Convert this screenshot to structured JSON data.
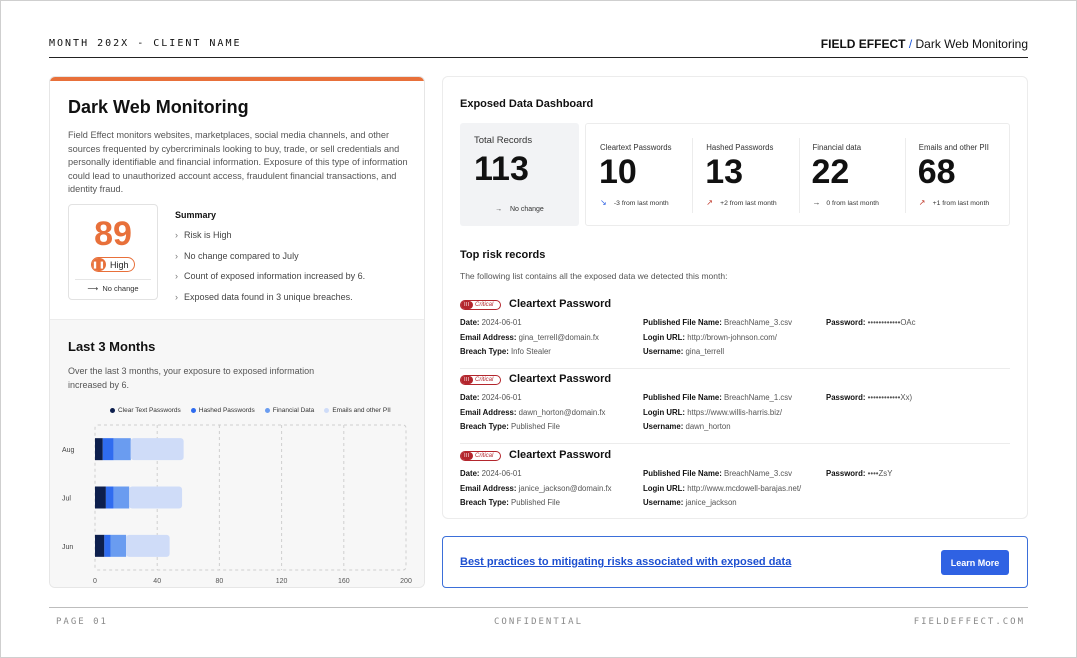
{
  "header": {
    "left": "MONTH 202X - CLIENT NAME",
    "brand": "FIELD EFFECT",
    "separator": "/",
    "section": "Dark Web Monitoring"
  },
  "overview": {
    "title": "Dark Web Monitoring",
    "description": "Field Effect monitors websites, marketplaces, social media channels, and other sources frequented by cybercriminals looking to buy, trade, or sell credentials and personally identifiable and financial information. Exposure of this type of information could lead to unauthorized account access, fraudulent financial transactions, and identity fraud.",
    "score": "89",
    "level": "High",
    "score_change": "No change",
    "summary_title": "Summary",
    "summary_items": [
      "Risk is High",
      "No change compared to July",
      "Count of exposed information increased by 6.",
      "Exposed data found in 3 unique breaches."
    ]
  },
  "last3": {
    "title": "Last 3 Months",
    "description": "Over the last 3 months, your exposure to exposed information increased by 6."
  },
  "chart_data": {
    "type": "bar",
    "orientation": "horizontal",
    "stacked": true,
    "categories": [
      "Aug",
      "Jul",
      "Jun"
    ],
    "series": [
      {
        "name": "Clear Text Passwords",
        "color": "#0d1f4d",
        "values": [
          5,
          7,
          6
        ]
      },
      {
        "name": "Hashed Passwords",
        "color": "#2f6cf0",
        "values": [
          7,
          5,
          4
        ]
      },
      {
        "name": "Financial Data",
        "color": "#6a9cf0",
        "values": [
          11,
          10,
          10
        ]
      },
      {
        "name": "Emails and other PII",
        "color": "#cfdcf8",
        "values": [
          34,
          34,
          28
        ]
      }
    ],
    "xticks": [
      0,
      40,
      80,
      120,
      160,
      200
    ],
    "xlim": [
      0,
      200
    ],
    "legend": "top"
  },
  "dashboard": {
    "title": "Exposed Data Dashboard",
    "total_label": "Total Records",
    "total_value": "113",
    "total_change_icon": "→",
    "total_change": "No change",
    "stats": [
      {
        "label": "Cleartext Passwords",
        "value": "10",
        "icon": "trend-down-icon",
        "glyph": "↘",
        "glyph_color": "#2f62e3",
        "change": "-3 from last month"
      },
      {
        "label": "Hashed Passwords",
        "value": "13",
        "icon": "trend-up-icon",
        "glyph": "↗",
        "glyph_color": "#c0392b",
        "change": "+2 from last month"
      },
      {
        "label": "Financial data",
        "value": "22",
        "icon": "arrow-right-icon",
        "glyph": "→",
        "glyph_color": "#333333",
        "change": "0 from last month"
      },
      {
        "label": "Emails and other PII",
        "value": "68",
        "icon": "trend-up-icon",
        "glyph": "↗",
        "glyph_color": "#c0392b",
        "change": "+1 from last month"
      }
    ]
  },
  "top_risk": {
    "title": "Top risk records",
    "description": "The following list contains all the exposed data we detected this month:",
    "records": [
      {
        "badge": "Critical",
        "title": "Cleartext Password",
        "date_label": "Date:",
        "date": "2024-06-01",
        "email_label": "Email Address:",
        "email": "gina_terrell@domain.fx",
        "breach_label": "Breach Type:",
        "breach": "Info Stealer",
        "file_label": "Published File Name:",
        "file": "BreachName_3.csv",
        "url_label": "Login URL:",
        "url": "http://brown-johnson.com/",
        "user_label": "Username:",
        "user": "gina_terrell",
        "password_label": "Password:",
        "password": "••••••••••••OAc"
      },
      {
        "badge": "Critical",
        "title": "Cleartext Password",
        "date_label": "Date:",
        "date": "2024-06-01",
        "email_label": "Email Address:",
        "email": "dawn_horton@domain.fx",
        "breach_label": "Breach Type:",
        "breach": "Published File",
        "file_label": "Published File Name:",
        "file": "BreachName_1.csv",
        "url_label": "Login URL:",
        "url": "https://www.willis-harris.biz/",
        "user_label": "Username:",
        "user": "dawn_horton",
        "password_label": "Password:",
        "password": "••••••••••••Xx)"
      },
      {
        "badge": "Critical",
        "title": "Cleartext Password",
        "date_label": "Date:",
        "date": "2024-06-01",
        "email_label": "Email Address:",
        "email": "janice_jackson@domain.fx",
        "breach_label": "Breach Type:",
        "breach": "Published File",
        "file_label": "Published File Name:",
        "file": "BreachName_3.csv",
        "url_label": "Login URL:",
        "url": "http://www.mcdowell-barajas.net/",
        "user_label": "Username:",
        "user": "janice_jackson",
        "password_label": "Password:",
        "password": "••••ZsY"
      }
    ]
  },
  "best_practices": {
    "link": "Best practices to mitigating risks associated with exposed data",
    "button": "Learn More"
  },
  "footer": {
    "page": "PAGE 01",
    "confidential": "CONFIDENTIAL",
    "site": "FIELDEFFECT.COM"
  },
  "colors": {
    "accent_orange": "#e8703a",
    "link_blue": "#1d4fd0",
    "button_blue": "#2f62e3",
    "critical_red": "#b3262d"
  }
}
